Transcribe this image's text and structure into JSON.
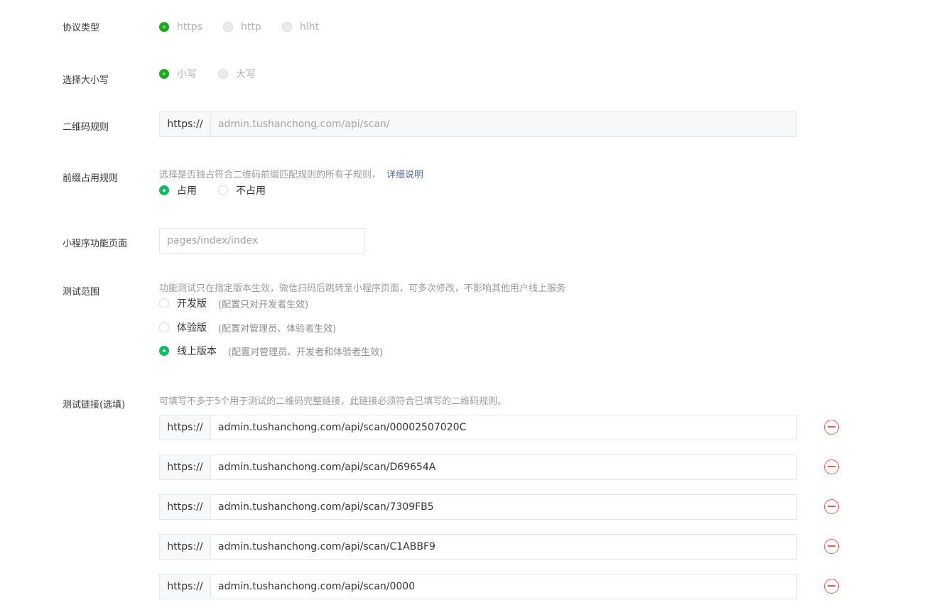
{
  "protocol": {
    "label": "协议类型",
    "options": [
      "https",
      "http",
      "hlht"
    ],
    "selected": "https"
  },
  "case": {
    "label": "选择大小写",
    "options": [
      "小写",
      "大写"
    ],
    "selected": "小写"
  },
  "qr_rule": {
    "label": "二维码规则",
    "prefix": "https://",
    "value": "admin.tushanchong.com/api/scan/"
  },
  "prefix_occupy": {
    "label": "前缀占用规则",
    "hint": "选择是否独占符合二维码前缀匹配规则的所有子规则，",
    "link": "详细说明",
    "options": [
      "占用",
      "不占用"
    ],
    "selected": "占用"
  },
  "mini_page": {
    "label": "小程序功能页面",
    "placeholder": "pages/index/index"
  },
  "test_scope": {
    "label": "测试范围",
    "hint": "功能测试只在指定版本生效，微信扫码后跳转至小程序页面，可多次修改，不影响其他用户线上服务",
    "options": [
      {
        "label": "开发版",
        "note": "(配置只对开发者生效)"
      },
      {
        "label": "体验版",
        "note": "(配置对管理员、体验者生效)"
      },
      {
        "label": "线上版本",
        "note": "(配置对管理员、开发者和体验者生效)"
      }
    ],
    "selected": "线上版本"
  },
  "test_links": {
    "label": "测试链接(选填)",
    "hint": "可填写不多于5个用于测试的二维码完整链接，此链接必须符合已填写的二维码规则。",
    "prefix": "https://",
    "links": [
      "admin.tushanchong.com/api/scan/00002507020C",
      "admin.tushanchong.com/api/scan/D69654A",
      "admin.tushanchong.com/api/scan/7309FB5",
      "admin.tushanchong.com/api/scan/C1ABBF9",
      "admin.tushanchong.com/api/scan/0000"
    ]
  },
  "colors": {
    "accent": "#07c160",
    "disabled_checked": "#1aad19",
    "danger": "#fa5151",
    "link": "#576b95"
  }
}
